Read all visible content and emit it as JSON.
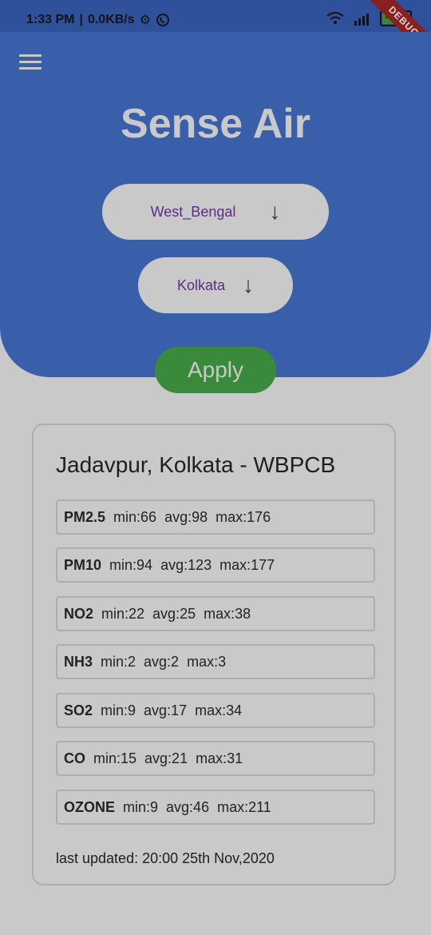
{
  "status": {
    "time": "1:33 PM",
    "speed": "0.0KB/s",
    "battery": "45",
    "debug_label": "DEBUG"
  },
  "app": {
    "title": "Sense Air"
  },
  "filters": {
    "state": "West_Bengal",
    "city": "Kolkata",
    "apply_label": "Apply"
  },
  "station": {
    "title": "Jadavpur, Kolkata - WBPCB",
    "pollutants": [
      {
        "name": "PM2.5",
        "min": "min:66",
        "avg": "avg:98",
        "max": "max:176"
      },
      {
        "name": "PM10",
        "min": "min:94",
        "avg": "avg:123",
        "max": "max:177"
      },
      {
        "name": "NO2",
        "min": "min:22",
        "avg": "avg:25",
        "max": "max:38"
      },
      {
        "name": "NH3",
        "min": "min:2",
        "avg": "avg:2",
        "max": "max:3"
      },
      {
        "name": "SO2",
        "min": "min:9",
        "avg": "avg:17",
        "max": "max:34"
      },
      {
        "name": "CO",
        "min": "min:15",
        "avg": "avg:21",
        "max": "max:31"
      },
      {
        "name": "OZONE",
        "min": "min:9",
        "avg": "avg:46",
        "max": "max:211"
      }
    ],
    "last_updated": "last updated: 20:00 25th Nov,2020"
  }
}
